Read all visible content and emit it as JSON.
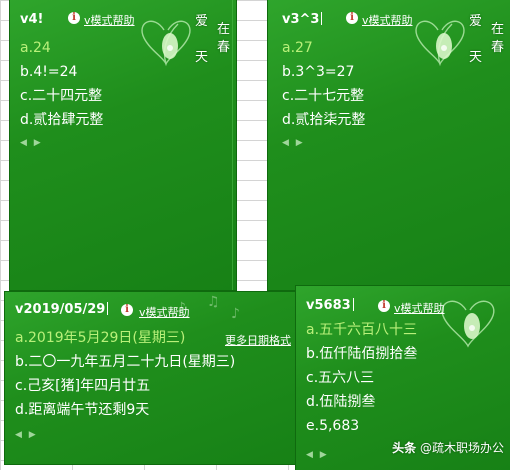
{
  "help_label": "v模式帮助",
  "poem_chars": [
    "爱",
    "在",
    "春",
    "天"
  ],
  "pager_glyph": "◀ ▶",
  "colors": {
    "panel_green": "#1f8e1c",
    "selected_candidate": "#b9f07a",
    "help_icon": "#c0392b"
  },
  "panels": [
    {
      "input_code": "v4!",
      "candidates": [
        "a.24",
        "b.4!=24",
        "c.二十四元整",
        "d.贰拾肆元整"
      ],
      "selected_index": 0
    },
    {
      "input_code": "v3^3",
      "candidates": [
        "a.27",
        "b.3^3=27",
        "c.二十七元整",
        "d.贰拾柒元整"
      ],
      "selected_index": 0
    },
    {
      "input_code": "v2019/05/29",
      "candidates": [
        "a.2019年5月29日(星期三)",
        "b.二〇一九年五月二十九日(星期三)",
        "c.己亥[猪]年四月廿五",
        "d.距离端午节还剩9天"
      ],
      "selected_index": 0,
      "more_label": "更多日期格式"
    },
    {
      "input_code": "v5683",
      "candidates": [
        "a.五千六百八十三",
        "b.伍仟陆佰捌拾叁",
        "c.五六八三",
        "d.伍陆捌叁",
        "e.5,683"
      ],
      "selected_index": 0
    }
  ],
  "watermark": {
    "prefix": "头条",
    "text": "@疏木职场办公"
  }
}
